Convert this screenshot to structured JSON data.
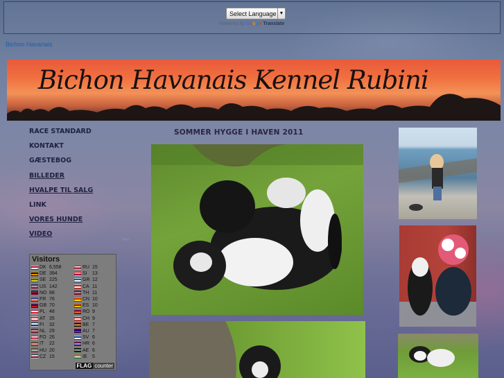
{
  "translate": {
    "select_label": "Select Language",
    "powered_by": "Powered by",
    "google_letters": [
      "G",
      "o",
      "o",
      "g",
      "l",
      "e"
    ],
    "translate_word": "Translate"
  },
  "site_link": "Bichon Havanais",
  "banner": {
    "title": "Bichon Havanais   Kennel Rubini"
  },
  "nav": {
    "items": [
      {
        "label": "RACE STANDARD",
        "underline": false
      },
      {
        "label": "KONTAKT",
        "underline": false
      },
      {
        "label": "GÆSTEBOG",
        "underline": false
      },
      {
        "label": "BILLEDER",
        "underline": true
      },
      {
        "label": "HVALPE TIL SALG",
        "underline": true
      },
      {
        "label": "LINK",
        "underline": false
      },
      {
        "label": "VORES HUNDE",
        "underline": true
      },
      {
        "label": "VIDEO",
        "underline": true
      }
    ]
  },
  "main": {
    "heading": "SOMMER HYGGE I HAVEN 2011"
  },
  "counter": {
    "title": "Visitors",
    "left": [
      {
        "cc": "DK",
        "count": "6,558",
        "colors": [
          "#c8102e",
          "#ffffff"
        ]
      },
      {
        "cc": "DE",
        "count": "394",
        "colors": [
          "#000000",
          "#dd0000",
          "#ffce00"
        ]
      },
      {
        "cc": "SE",
        "count": "225",
        "colors": [
          "#006aa7",
          "#fecc00"
        ]
      },
      {
        "cc": "US",
        "count": "142",
        "colors": [
          "#b22234",
          "#ffffff",
          "#3c3b6e"
        ]
      },
      {
        "cc": "NO",
        "count": "88",
        "colors": [
          "#ba0c2f",
          "#00205b"
        ]
      },
      {
        "cc": "FR",
        "count": "76",
        "colors": [
          "#0055a4",
          "#ffffff",
          "#ef4135"
        ]
      },
      {
        "cc": "GB",
        "count": "70",
        "colors": [
          "#012169",
          "#c8102e"
        ]
      },
      {
        "cc": "PL",
        "count": "48",
        "colors": [
          "#ffffff",
          "#dc143c"
        ]
      },
      {
        "cc": "AT",
        "count": "35",
        "colors": [
          "#ed2939",
          "#ffffff"
        ]
      },
      {
        "cc": "FI",
        "count": "32",
        "colors": [
          "#ffffff",
          "#003580"
        ]
      },
      {
        "cc": "NL",
        "count": "29",
        "colors": [
          "#ae1c28",
          "#ffffff",
          "#21468b"
        ]
      },
      {
        "cc": "FO",
        "count": "26",
        "colors": [
          "#ffffff",
          "#0065bd",
          "#ef303e"
        ]
      },
      {
        "cc": "IT",
        "count": "22",
        "colors": [
          "#009246",
          "#ffffff",
          "#ce2b37"
        ]
      },
      {
        "cc": "HU",
        "count": "20",
        "colors": [
          "#ce2939",
          "#ffffff",
          "#477050"
        ]
      },
      {
        "cc": "CZ",
        "count": "15",
        "colors": [
          "#ffffff",
          "#d7141a",
          "#11457e"
        ]
      }
    ],
    "right": [
      {
        "cc": "RU",
        "count": "15",
        "colors": [
          "#ffffff",
          "#0039a6",
          "#d52b1e"
        ]
      },
      {
        "cc": "SI",
        "count": "13",
        "colors": [
          "#ffffff",
          "#0000ff",
          "#ff0000"
        ]
      },
      {
        "cc": "GR",
        "count": "12",
        "colors": [
          "#0d5eaf",
          "#ffffff"
        ]
      },
      {
        "cc": "CA",
        "count": "11",
        "colors": [
          "#ff0000",
          "#ffffff"
        ]
      },
      {
        "cc": "TH",
        "count": "11",
        "colors": [
          "#a51931",
          "#f4f5f8",
          "#2d2a4a"
        ]
      },
      {
        "cc": "CN",
        "count": "10",
        "colors": [
          "#de2910",
          "#ffde00"
        ]
      },
      {
        "cc": "ES",
        "count": "10",
        "colors": [
          "#aa151b",
          "#f1bf00"
        ]
      },
      {
        "cc": "RO",
        "count": "9",
        "colors": [
          "#002b7f",
          "#fcd116",
          "#ce1126"
        ]
      },
      {
        "cc": "CH",
        "count": "9",
        "colors": [
          "#ff0000",
          "#ffffff"
        ]
      },
      {
        "cc": "BE",
        "count": "7",
        "colors": [
          "#000000",
          "#fae042",
          "#ed2939"
        ]
      },
      {
        "cc": "AU",
        "count": "7",
        "colors": [
          "#00008b",
          "#ff0000"
        ]
      },
      {
        "cc": "SV",
        "count": "6",
        "colors": [
          "#0f47af",
          "#ffffff"
        ]
      },
      {
        "cc": "HR",
        "count": "6",
        "colors": [
          "#ff0000",
          "#ffffff",
          "#171796"
        ]
      },
      {
        "cc": "AE",
        "count": "6",
        "colors": [
          "#00732f",
          "#ffffff",
          "#000000"
        ]
      },
      {
        "cc": "IE",
        "count": "5",
        "colors": [
          "#169b62",
          "#ffffff",
          "#ff883e"
        ]
      }
    ],
    "footer_flag": "FLAG",
    "footer_counter": "counter"
  }
}
